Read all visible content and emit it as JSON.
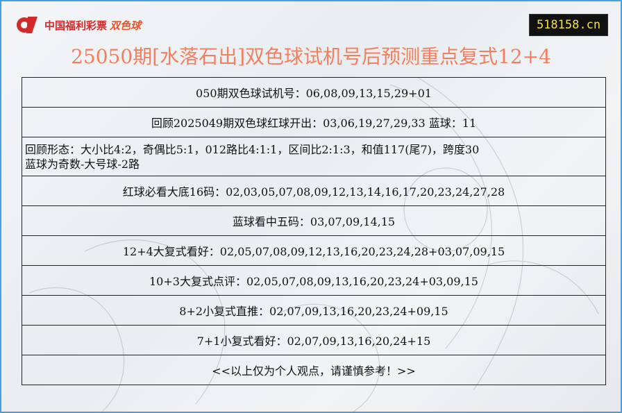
{
  "brand": {
    "logo_text": "中国福利彩票",
    "game_name": "双色球"
  },
  "site": {
    "domain": "518158.cn"
  },
  "title": "25050期[水落石出]双色球试机号后预测重点复式12+4",
  "rows": [
    "050期双色球试机号：06,08,09,13,15,29+01",
    "回顾2025049期双色球红球开出：03,06,19,27,29,33 蓝球：11",
    "回顾形态：大小比4:2，奇偶比5:1，012路比4:1:1，区间比2:1:3，和值117(尾7)，跨度30",
    "蓝球为奇数-大号球-2路",
    "红球必看大底16码：02,03,05,07,08,09,12,13,14,16,17,20,23,24,27,28",
    "蓝球看中五码：03,07,09,14,15",
    "12+4大复式看好：02,05,07,08,09,12,13,16,20,23,24,28+03,07,09,15",
    "10+3大复式点评：02,05,07,08,09,13,16,20,23,24+03,09,15",
    "8+2小复式直推：02,07,09,13,16,20,23,24+09,15",
    "7+1小复式看好：02,07,09,13,16,20,24+15",
    "<<以上仅为个人观点，请谨慎参考！>>"
  ]
}
